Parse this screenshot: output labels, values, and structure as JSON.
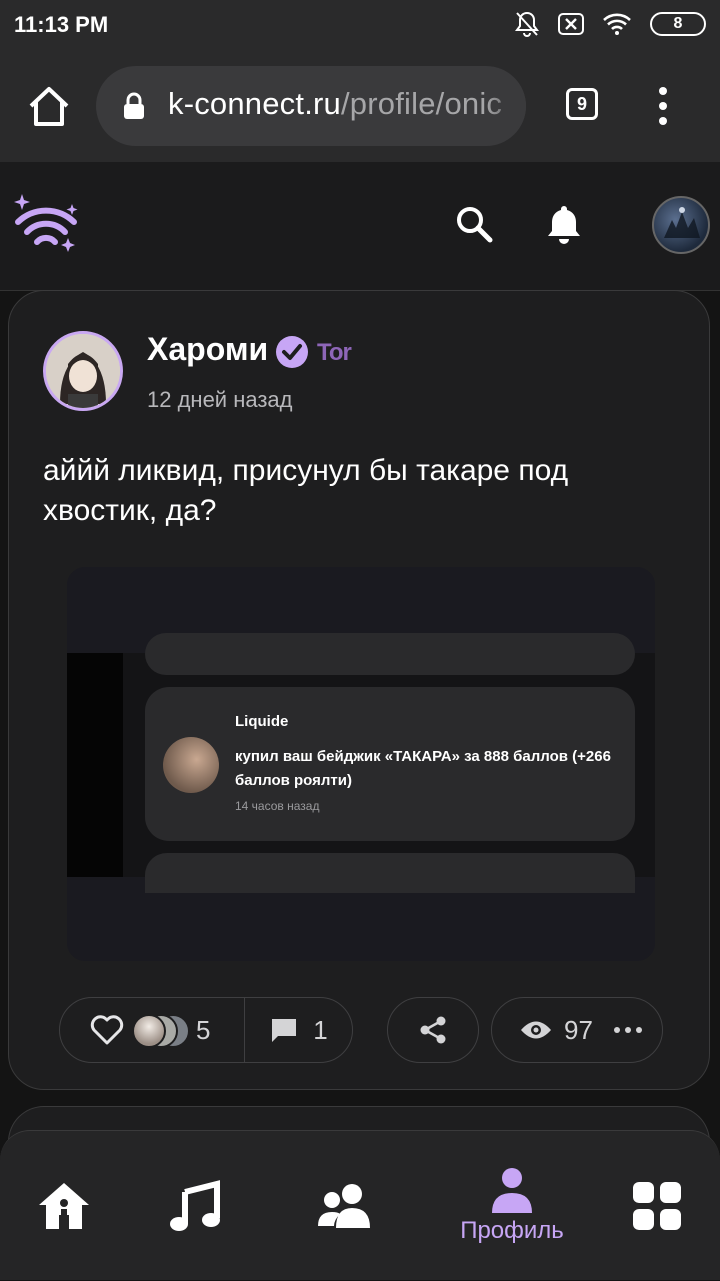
{
  "status_bar": {
    "time": "11:13 PM",
    "battery": "8",
    "icons": [
      "bell-muted-icon",
      "sim-off-icon",
      "wifi-icon",
      "battery-icon"
    ]
  },
  "browser": {
    "url_host": "k-connect.ru",
    "url_path": "/profile/onic",
    "tab_count": "9",
    "icons": [
      "home-icon",
      "lock-icon",
      "tabs-icon",
      "menu-dots-icon"
    ]
  },
  "app_bar": {
    "icons": [
      "logo-wifi-sparkle-icon",
      "search-icon",
      "bell-icon",
      "user-avatar"
    ]
  },
  "post": {
    "author": "Хароми",
    "badge_text": "Tor",
    "time": "12 дней назад",
    "text": "аййй ликвид, присунул бы такаре под хвостик, да?",
    "image": {
      "username": "Liquide",
      "message": "купил ваш бейджик «ТАКАРА» за 888 баллов (+266 баллов роялти)",
      "time": "14 часов назад"
    },
    "likes": "5",
    "comments": "1",
    "views": "97"
  },
  "bottom_nav": {
    "items": [
      {
        "name": "home",
        "icon": "home-icon"
      },
      {
        "name": "music",
        "icon": "music-icon"
      },
      {
        "name": "friends",
        "icon": "users-icon"
      },
      {
        "name": "profile",
        "icon": "profile-icon",
        "label": "Профиль",
        "active": true
      },
      {
        "name": "more",
        "icon": "apps-grid-icon"
      }
    ]
  },
  "colors": {
    "accent": "#c7a6f5",
    "background": "#141414",
    "card": "#1e1e1f",
    "chrome": "#2a2a2b"
  }
}
